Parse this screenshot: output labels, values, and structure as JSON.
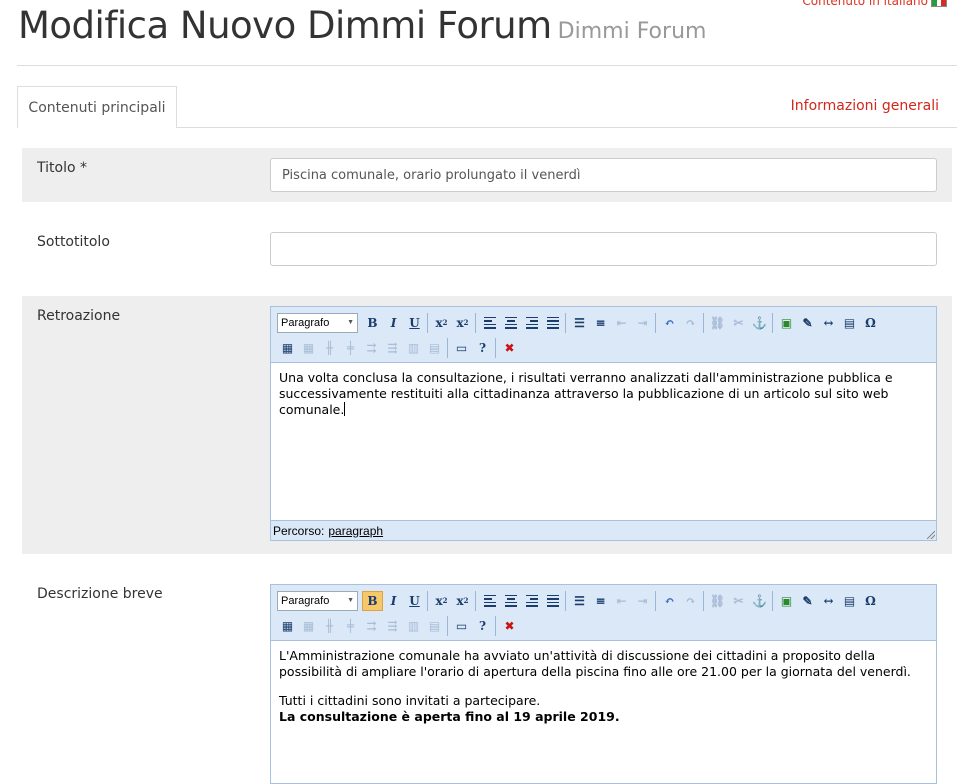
{
  "header": {
    "language_note": "Contenuto in italiano",
    "title": "Modifica Nuovo Dimmi Forum",
    "subtitle": "Dimmi Forum"
  },
  "tabs": {
    "active": "Contenuti principali",
    "other": "Informazioni generali"
  },
  "form": {
    "title_label": "Titolo *",
    "title_value": "Piscina comunale, orario prolungato il venerdì",
    "subtitle_label": "Sottotitolo",
    "subtitle_value": "",
    "feedback_label": "Retroazione",
    "summary_label": "Descrizione breve"
  },
  "editor": {
    "format_select": "Paragrafo",
    "path_label": "Percorso:",
    "path_value": "paragraph"
  },
  "feedback_editor": {
    "text": "Una volta conclusa la consultazione, i risultati verranno analizzati dall'amministrazione pubblica e successivamente restituiti alla cittadinanza attraverso la pubblicazione di un articolo sul sito web comunale."
  },
  "summary_editor": {
    "paragraph1": "L'Amministrazione comunale ha avviato un'attività di discussione dei cittadini a proposito della possibilità di ampliare l'orario di apertura della piscina fino alle ore 21.00 per la giornata del venerdì.",
    "paragraph2": "Tutti i cittadini sono invitati a partecipare.",
    "paragraph3": "La consultazione è aperta fino al 19 aprile  2019."
  },
  "colors": {
    "accent_link": "#d3261c",
    "toolbar_bg": "#dbe8f7",
    "row_gray": "#eeeeee"
  }
}
